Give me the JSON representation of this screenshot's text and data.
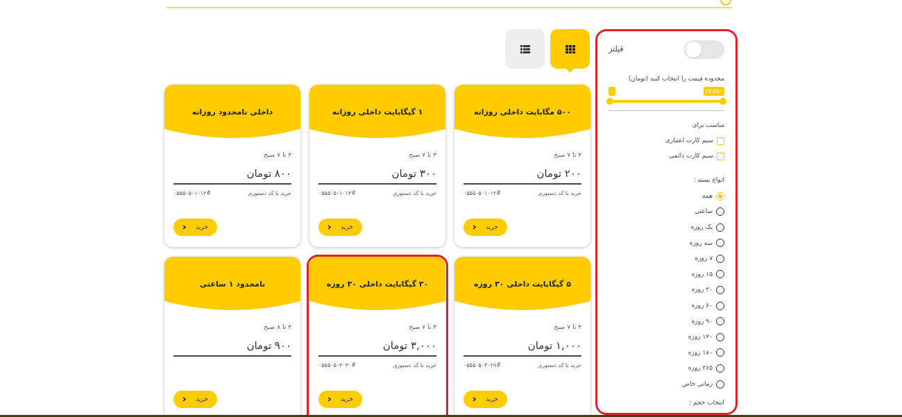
{
  "view_toggle": [
    {
      "kind": "grid",
      "selected": true
    },
    {
      "kind": "list",
      "selected": false
    }
  ],
  "cards": [
    {
      "title": "۵۰۰ مگابایت داخلی روزانه",
      "time": "۲ تا ۷ صبح",
      "price": "۲۰۰ تومان",
      "code_label": "خرید با کد دستوری",
      "code": "۰۵۵۵۰۵۰۱۰۱۲#",
      "button": "خرید",
      "highlighted": false
    },
    {
      "title": "۱ گیگابایت داخلی روزانه",
      "time": "۲ تا ۷ صبح",
      "price": "۳۰۰ تومان",
      "code_label": "خرید با کد دستوری",
      "code": "۰۵۵۵۰۵۰۱۰۱۳#",
      "button": "خرید",
      "highlighted": false
    },
    {
      "title": "داخلی نامحدود روزانه",
      "time": "۲ تا ۷ صبح",
      "price": "۸۰۰ تومان",
      "code_label": "خرید با کد دستوری",
      "code": "۰۵۵۵۰۵۰۱۰۱۴#",
      "button": "خرید",
      "highlighted": false
    },
    {
      "title": "۵ گیگابایت داخلی ۳۰ روزه",
      "time": "۲ تا ۷ صبح",
      "price": "۱,۰۰۰ تومان",
      "code_label": "خرید با کد دستوری",
      "code": "۰۵۵۵۰۵۰۳۰۲۹#",
      "button": "خرید",
      "highlighted": false
    },
    {
      "title": "۳۰ گیگابایت داخلی ۳۰ روزه",
      "time": "۲ تا ۷ صبح",
      "price": "۳,۰۰۰ تومان",
      "code_label": "خرید با کد دستوری",
      "code": "۰۵۵۵۰۵۰۳۰۳۰#",
      "button": "خرید",
      "highlighted": true
    },
    {
      "title": "نامحدود ۱ ساعتی",
      "time": "۲ تا ۸ صبح",
      "price": "۹۰۰ تومان",
      "button": "خرید",
      "highlighted": false
    }
  ],
  "filter": {
    "highlighted": true,
    "label": "فیلتر",
    "on": false,
    "price_range": {
      "label": "محدوده قیمت را انتخاب کنید (تومان)",
      "min": "۰",
      "max": "۲۲,۵۵۰",
      "level": 1
    },
    "suitable_for": {
      "label": "مناسب برای",
      "options": [
        {
          "label": "سیم کارت اعتباری",
          "checked": false
        },
        {
          "label": "سیم کارت دائمی",
          "checked": false
        }
      ]
    },
    "package_types": {
      "label": "انواع بسته :",
      "options": [
        {
          "label": "همه",
          "selected": true
        },
        {
          "label": "ساعتی",
          "selected": false
        },
        {
          "label": "یک روزه",
          "selected": false
        },
        {
          "label": "سه روزه",
          "selected": false
        },
        {
          "label": "۷ روزه",
          "selected": false
        },
        {
          "label": "۱۵ روزه",
          "selected": false
        },
        {
          "label": "۳۰ روزه",
          "selected": false
        },
        {
          "label": "۶۰ روزه",
          "selected": false
        },
        {
          "label": "۹۰ روزه",
          "selected": false
        },
        {
          "label": "۱۲۰ روزه",
          "selected": false
        },
        {
          "label": "۱۸۰ روزه",
          "selected": false
        },
        {
          "label": "۳۶۵ روزه",
          "selected": false
        },
        {
          "label": "زمانی خاص",
          "selected": false
        }
      ]
    },
    "volume_label": "انتخاب حجم :"
  }
}
